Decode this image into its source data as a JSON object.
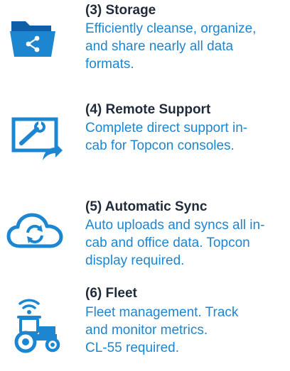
{
  "colors": {
    "accent": "#1c86d1",
    "title": "#1f2b3a",
    "icon_dark": "#0f5fa8"
  },
  "features": [
    {
      "icon": "folder-share-icon",
      "title": "(3) Storage",
      "desc": [
        "Efficiently cleanse, organize,",
        "and share nearly all data",
        "formats."
      ]
    },
    {
      "icon": "remote-support-icon",
      "title": "(4) Remote Support",
      "desc": [
        "Complete direct support in-",
        "cab for Topcon consoles."
      ]
    },
    {
      "icon": "cloud-sync-icon",
      "title": "(5) Automatic Sync",
      "desc": [
        "Auto uploads and syncs all in-",
        "cab and office data. Topcon",
        "display required."
      ]
    },
    {
      "icon": "tractor-wifi-icon",
      "title": "(6) Fleet",
      "desc": [
        "Fleet management. Track",
        "and monitor metrics.",
        "CL-55 required."
      ]
    }
  ]
}
